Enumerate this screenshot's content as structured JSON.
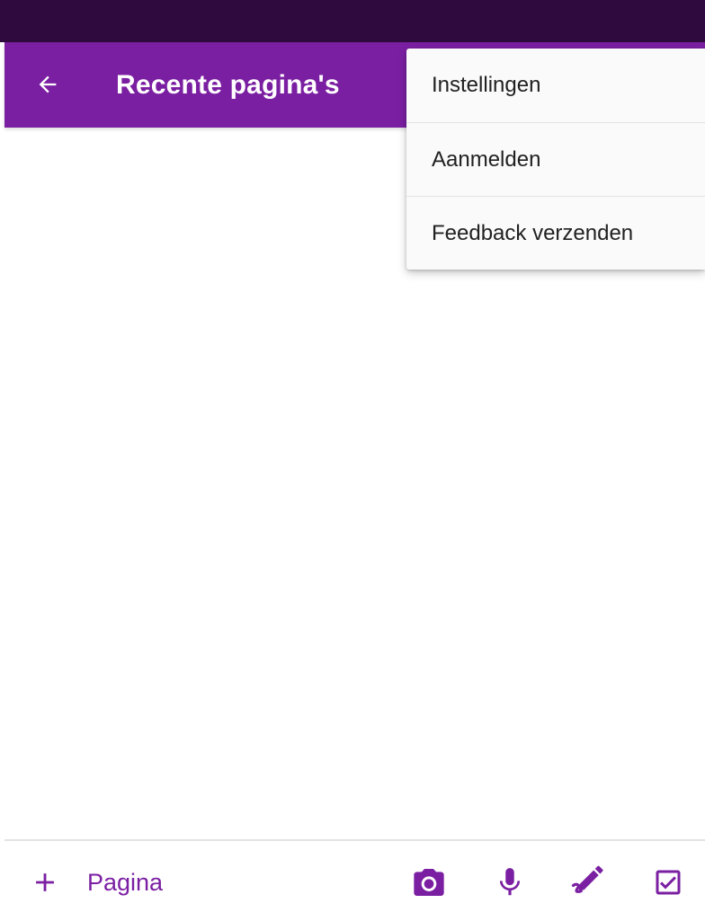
{
  "app_bar": {
    "title": "Recente pagina's",
    "back_icon": "arrow-left-icon"
  },
  "overflow_menu": {
    "items": [
      {
        "label": "Instellingen"
      },
      {
        "label": "Aanmelden"
      },
      {
        "label": "Feedback verzenden"
      }
    ]
  },
  "bottom_bar": {
    "add_page_label": "Pagina",
    "add_icon": "plus-icon",
    "tools": [
      {
        "icon": "camera-icon"
      },
      {
        "icon": "microphone-icon"
      },
      {
        "icon": "pen-icon"
      },
      {
        "icon": "checkbox-icon"
      }
    ]
  },
  "colors": {
    "status_bar": "#2e0a3e",
    "accent": "#7b1fa2",
    "menu_background": "#fafafa",
    "menu_text": "#212121"
  }
}
